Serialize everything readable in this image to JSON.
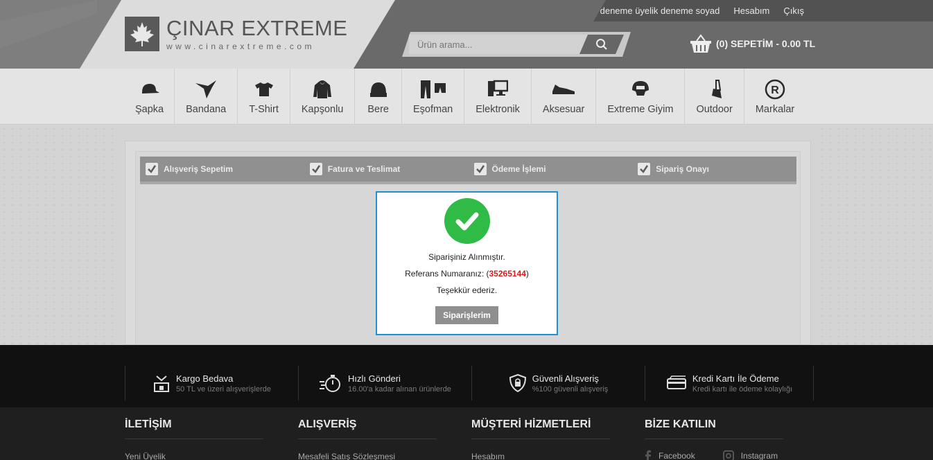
{
  "header": {
    "brand": "ÇINAR EXTREME",
    "url": "www.cinarextreme.com",
    "top_links": {
      "user": "deneme üyelik deneme soyad",
      "account": "Hesabım",
      "logout": "Çıkış"
    },
    "search": {
      "placeholder": "Ürün arama..."
    },
    "cart": {
      "label": "(0) SEPETİM - 0.00 TL"
    }
  },
  "nav": {
    "items": [
      {
        "label": "Şapka",
        "icon": "cap-icon"
      },
      {
        "label": "Bandana",
        "icon": "bandana-icon"
      },
      {
        "label": "T-Shirt",
        "icon": "tshirt-icon"
      },
      {
        "label": "Kapşonlu",
        "icon": "hoodie-icon"
      },
      {
        "label": "Bere",
        "icon": "beanie-icon"
      },
      {
        "label": "Eşofman",
        "icon": "tracksuit-icon"
      },
      {
        "label": "Elektronik",
        "icon": "computer-icon"
      },
      {
        "label": "Aksesuar",
        "icon": "sneaker-icon"
      },
      {
        "label": "Extreme Giyim",
        "icon": "helmet-icon"
      },
      {
        "label": "Outdoor",
        "icon": "knife-icon"
      },
      {
        "label": "Markalar",
        "icon": "registered-icon"
      }
    ]
  },
  "steps": [
    "Alışveriş Sepetim",
    "Fatura ve Teslimat",
    "Ödeme İşlemi",
    "Sipariş Onayı"
  ],
  "modal": {
    "message": "Siparişiniz Alınmıştır.",
    "ref_label": "Referans Numaranız: (",
    "ref_number": "35265144",
    "ref_close": ")",
    "thanks": "Teşekkür ederiz.",
    "button": "Siparişlerim"
  },
  "features": [
    {
      "title": "Kargo Bedava",
      "sub": "50 TL ve üzeri alışverişlerde",
      "icon": "shipping-icon"
    },
    {
      "title": "Hızlı Gönderi",
      "sub": "16.00'a kadar alınan ürünlerde",
      "icon": "stopwatch-icon"
    },
    {
      "title": "Güvenli Alışveriş",
      "sub": "%100 güvenli alışveriş",
      "icon": "lock-shield-icon"
    },
    {
      "title": "Kredi Kartı İle Ödeme",
      "sub": "Kredi kartı ile ödeme kolaylığı",
      "icon": "credit-card-icon"
    }
  ],
  "footer": {
    "cols": [
      {
        "title": "İLETİŞİM",
        "link": "Yeni Üyelik"
      },
      {
        "title": "ALIŞVERİŞ",
        "link": "Mesafeli Satış Sözleşmesi"
      },
      {
        "title": "MÜŞTERİ HİZMETLERİ",
        "link": "Hesabım"
      },
      {
        "title": "BİZE KATILIN"
      }
    ],
    "social": {
      "facebook": "Facebook",
      "instagram": "Instagram"
    }
  },
  "colors": {
    "accent": "#1f8fd8",
    "success": "#2fbb45",
    "ref_red": "#d21f1f"
  }
}
